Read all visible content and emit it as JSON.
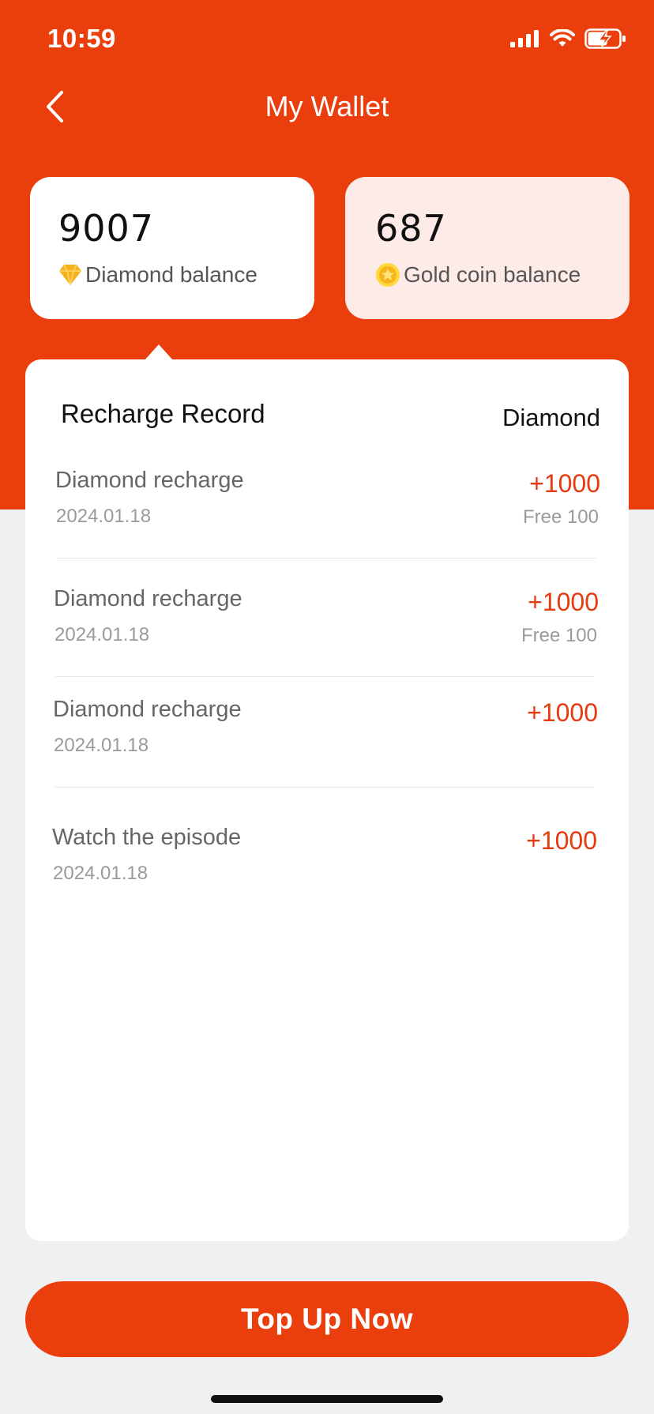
{
  "status_bar": {
    "time": "10:59"
  },
  "nav": {
    "title": "My Wallet"
  },
  "balances": {
    "diamond": {
      "value": "9007",
      "label": "Diamond balance"
    },
    "gold": {
      "value": "687",
      "label": "Gold coin balance"
    }
  },
  "records": {
    "heading": "Recharge Record",
    "filter": "Diamond",
    "items": [
      {
        "title": "Diamond recharge",
        "date": "2024.01.18",
        "amount": "+1000",
        "bonus": "Free 100"
      },
      {
        "title": "Diamond recharge",
        "date": "2024.01.18",
        "amount": "+1000",
        "bonus": "Free 100"
      },
      {
        "title": "Diamond recharge",
        "date": "2024.01.18",
        "amount": "+1000",
        "bonus": ""
      },
      {
        "title": "Watch the episode",
        "date": "2024.01.18",
        "amount": "+1000",
        "bonus": ""
      }
    ]
  },
  "actions": {
    "topup_label": "Top Up Now"
  },
  "colors": {
    "brand": "#ea3e0d",
    "amount": "#e63a0f",
    "gold_card_bg": "#fdebe7",
    "page_bg": "#eef0f2"
  },
  "icons": [
    "signal-icon",
    "wifi-icon",
    "battery-charging-icon",
    "back-chevron-icon",
    "diamond-icon",
    "gold-coin-icon"
  ]
}
